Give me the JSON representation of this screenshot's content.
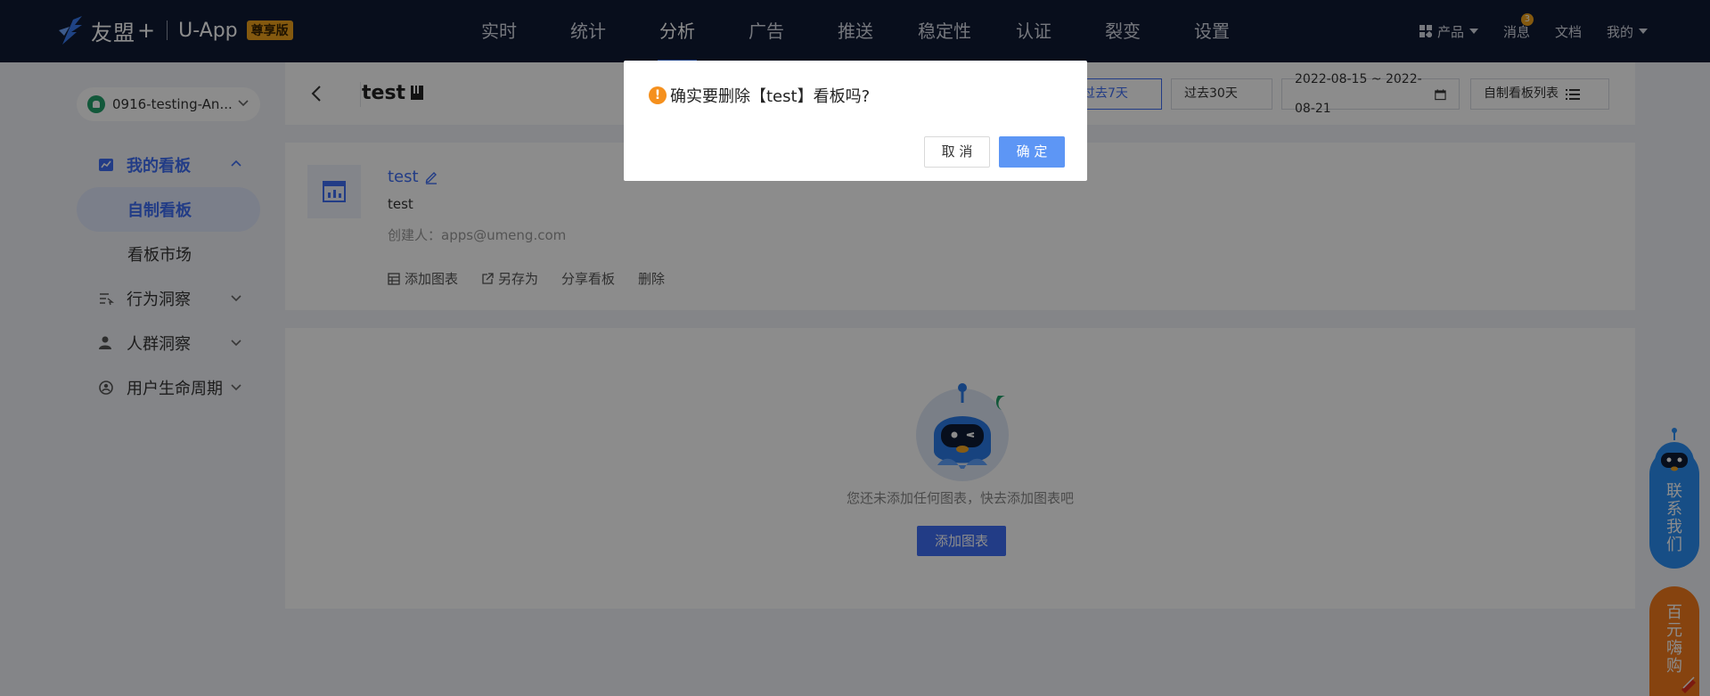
{
  "topbar": {
    "brand": "友盟",
    "brand_plus": "+",
    "app": "U-App",
    "badge": "尊享版",
    "nav": [
      "实时",
      "统计",
      "分析",
      "广告",
      "推送",
      "稳定性",
      "认证",
      "裂变",
      "设置"
    ],
    "active_nav": "分析",
    "products": "产品",
    "messages": "消息",
    "message_count": "3",
    "docs": "文档",
    "mine": "我的"
  },
  "sidebar": {
    "app_name": "0916-testing-An...",
    "my_boards": "我的看板",
    "custom_boards": "自制看板",
    "board_market": "看板市场",
    "behavior": "行为洞察",
    "crowd": "人群洞察",
    "lifecycle": "用户生命周期"
  },
  "header": {
    "title": "test",
    "range_7": "过去7天",
    "range_30": "过去30天",
    "date_range": "2022-08-15 ~ 2022-08-21",
    "board_list": "自制看板列表"
  },
  "board": {
    "name": "test",
    "desc": "test",
    "creator_label": "创建人：",
    "creator": "apps@umeng.com",
    "add_chart": "添加图表",
    "save_as": "另存为",
    "share": "分享看板",
    "delete": "删除"
  },
  "empty": {
    "text": "您还未添加任何图表，快去添加图表吧",
    "button": "添加图表"
  },
  "float": {
    "contact": [
      "联",
      "系",
      "我",
      "们"
    ],
    "buy": [
      "百",
      "元",
      "嗨",
      "购"
    ]
  },
  "modal": {
    "message": "确实要删除【test】看板吗?",
    "cancel": "取 消",
    "ok": "确 定"
  },
  "colors": {
    "nav_bg": "#0f1a33",
    "accent": "#3f6ef5",
    "warning": "#f5901d",
    "contact_blue": "#2a8ef5",
    "buy_orange": "#f47a1c"
  }
}
